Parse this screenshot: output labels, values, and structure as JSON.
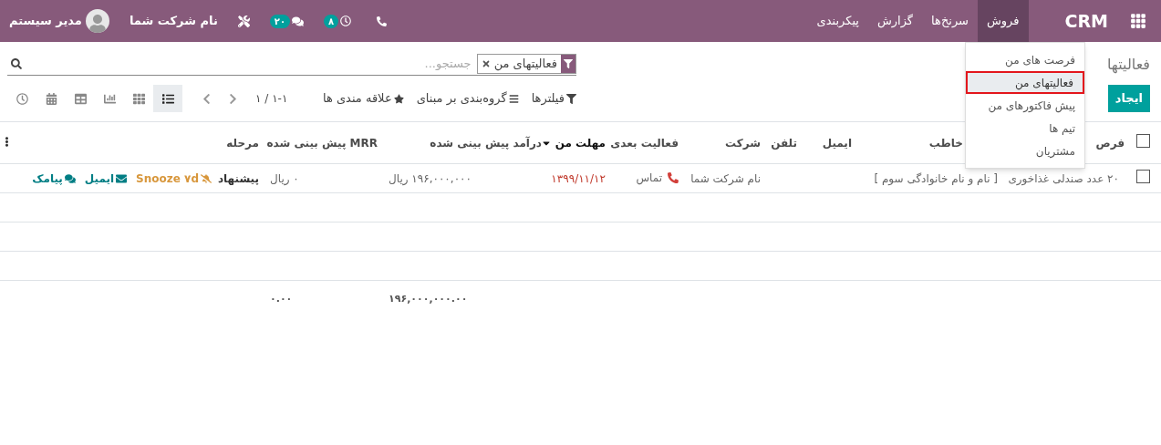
{
  "header": {
    "app_name": "CRM",
    "menus": [
      {
        "label": "فروش",
        "selected": true
      },
      {
        "label": "سرنخ‌ها",
        "selected": false
      },
      {
        "label": "گزارش",
        "selected": false
      },
      {
        "label": "پیکربندی",
        "selected": false
      }
    ],
    "activity_count": "۸",
    "message_count": "۲۰",
    "company": "نام شرکت شما",
    "user": "مدیر سیستم"
  },
  "dropdown": {
    "items": [
      {
        "label": "فرصت های من",
        "selected": false
      },
      {
        "label": "فعالیتهای من",
        "selected": true
      },
      {
        "label": "پیش فاکتورهای من",
        "selected": false
      },
      {
        "label": "تیم ها",
        "selected": false
      },
      {
        "label": "مشتریان",
        "selected": false
      }
    ]
  },
  "breadcrumb": "فعالیتها",
  "search": {
    "facet": "فعالیتهای من",
    "placeholder": "جستجو..."
  },
  "create_button": "ایجاد",
  "filters": [
    {
      "kind": "filter",
      "label": "فیلترها"
    },
    {
      "kind": "groupby",
      "label": "گروه‌بندی بر مبنای"
    },
    {
      "kind": "favorites",
      "label": "علاقه مندی ها"
    }
  ],
  "pager": "۱-۱ / ۱",
  "views": [
    {
      "kind": "list",
      "selected": true
    },
    {
      "kind": "kanban",
      "selected": false
    },
    {
      "kind": "graph",
      "selected": false
    },
    {
      "kind": "pivot",
      "selected": false
    },
    {
      "kind": "calendar",
      "selected": false
    },
    {
      "kind": "activity",
      "selected": false
    }
  ],
  "table": {
    "select_all_checked": false,
    "columns": [
      {
        "label": "فرص",
        "sorted": false
      },
      {
        "label": "خاطب",
        "sorted": false
      },
      {
        "label": "ایمیل",
        "sorted": false
      },
      {
        "label": "تلفن",
        "sorted": false
      },
      {
        "label": "شرکت",
        "sorted": false
      },
      {
        "label": "فعالیت بعدی",
        "sorted": false
      },
      {
        "label": "مهلت من",
        "sorted": true
      },
      {
        "label": "درآمد پیش بینی شده",
        "sorted": false
      },
      {
        "label": "MRR پیش بینی شده",
        "sorted": false
      },
      {
        "label": "مرحله",
        "sorted": false
      }
    ],
    "rows": [
      {
        "checked": false,
        "opportunity": "۲۰ عدد صندلی غذاخوری",
        "contact": "[ نام و نام خانوادگی سوم ]",
        "company": "نام شرکت شما",
        "next_activity": "تماس",
        "deadline": "۱۳۹۹/۱۱/۱۲",
        "revenue": "۱۹۶,۰۰۰,۰۰۰ ریال",
        "mrr": "۰ ریال",
        "stage": "پیشنهاد",
        "actions": [
          {
            "kind": "snooze",
            "label": "Snooze ۷d",
            "color": "#d8973c"
          },
          {
            "kind": "email",
            "label": "ایمیل",
            "color": "#017e84"
          },
          {
            "kind": "sms",
            "label": "پیامک",
            "color": "#017e84"
          }
        ]
      }
    ],
    "totals": {
      "revenue": "۱۹۶,۰۰۰,۰۰۰.۰۰",
      "mrr": "۰.۰۰"
    }
  }
}
